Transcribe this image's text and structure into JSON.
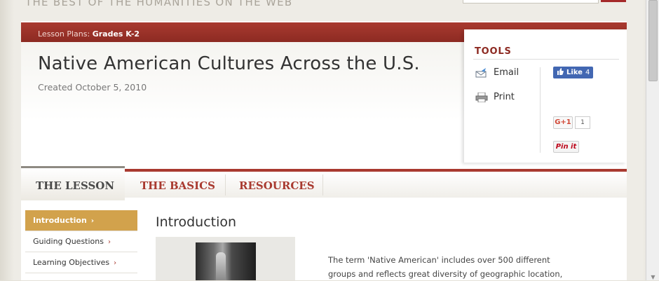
{
  "site": {
    "tagline": "THE BEST OF THE HUMANITIES ON THE WEB"
  },
  "header": {
    "crumb_label": "Lesson Plans:",
    "crumb_value": "Grades K-2"
  },
  "lesson": {
    "title": "Native American Cultures Across the U.S.",
    "created": "Created October 5, 2010"
  },
  "tools": {
    "title": "TOOLS",
    "email_label": "Email",
    "print_label": "Print",
    "like_label": "Like",
    "like_count": "4",
    "gplus_label": "G+1",
    "gplus_count": "1",
    "pinit_label": "Pin it"
  },
  "tabs": [
    {
      "label": "THE LESSON",
      "active": true
    },
    {
      "label": "THE BASICS",
      "active": false
    },
    {
      "label": "RESOURCES",
      "active": false
    }
  ],
  "sidebar": {
    "items": [
      {
        "label": "Introduction",
        "active": true
      },
      {
        "label": "Guiding Questions",
        "active": false
      },
      {
        "label": "Learning Objectives",
        "active": false
      }
    ]
  },
  "main": {
    "section_title": "Introduction",
    "intro_line1": "The term 'Native American' includes over 500 different",
    "intro_line2": "groups and reflects great diversity of geographic location,"
  },
  "colors": {
    "brand_red": "#a93a30",
    "active_gold": "#d2a24c",
    "facebook_blue": "#4267b2"
  }
}
